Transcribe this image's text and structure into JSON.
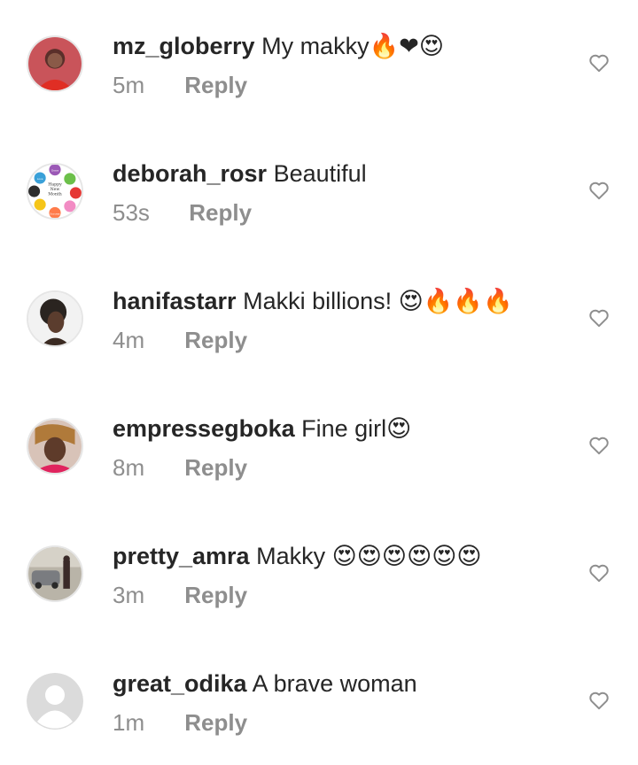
{
  "comments": [
    {
      "username": "mz_globerry",
      "text": "My makky",
      "emoji": "🔥❤😍",
      "time": "5m",
      "reply": "Reply"
    },
    {
      "username": "deborah_rosr",
      "text": "Beautiful",
      "emoji": "",
      "time": "53s",
      "reply": "Reply"
    },
    {
      "username": "hanifastarr",
      "text": "Makki billions!",
      "emoji": "😍🔥🔥🔥",
      "time": "4m",
      "reply": "Reply"
    },
    {
      "username": "empressegboka",
      "text": "Fine girl",
      "emoji": "😍",
      "time": "8m",
      "reply": "Reply"
    },
    {
      "username": "pretty_amra",
      "text": "Makky",
      "emoji": "😍😍😍😍😍😍",
      "time": "3m",
      "reply": "Reply"
    },
    {
      "username": "great_odika",
      "text": "A brave woman",
      "emoji": "",
      "time": "1m",
      "reply": "Reply"
    }
  ],
  "avatar_story_text": {
    "lines": [
      "Love",
      "Grace",
      "Happy",
      "New",
      "Month",
      "Success"
    ]
  },
  "colors": {
    "username": "#262626",
    "secondary": "#8e8e8e",
    "heart_outline": "#8e8e8e"
  },
  "icons": {
    "like": "heart-outline-icon",
    "default_avatar": "default-avatar-icon"
  }
}
